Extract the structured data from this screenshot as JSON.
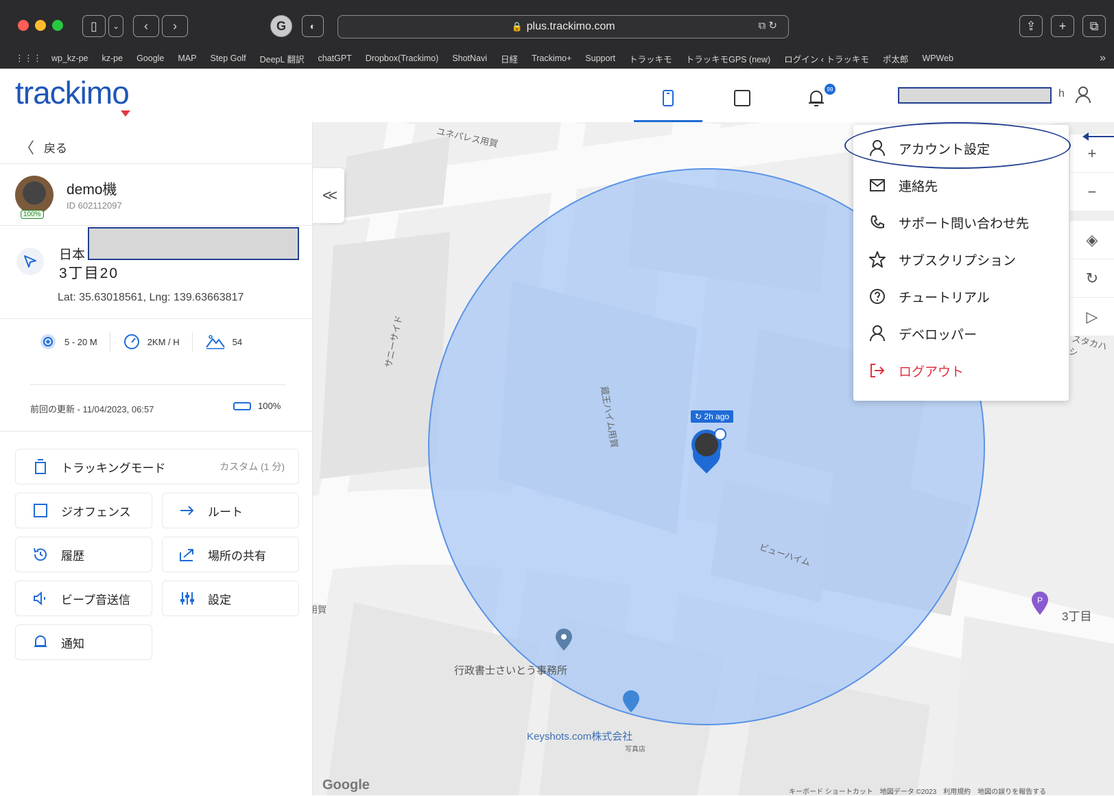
{
  "browser": {
    "url": "plus.trackimo.com",
    "bookmarks": [
      "wp_kz-pe",
      "kz-pe",
      "Google",
      "MAP",
      "Step Golf",
      "DeepL 翻訳",
      "chatGPT",
      "Dropbox(Trackimo)",
      "ShotNavi",
      "日経",
      "Trackimo+",
      "Support",
      "トラッキモ",
      "トラッキモGPS (new)",
      "ログイン ‹ トラッキモ",
      "ポ太郎",
      "WPWeb"
    ],
    "more": "»"
  },
  "app": {
    "logo": "trackimo",
    "notification_badge": "99"
  },
  "panel": {
    "back": "戻る",
    "device_name": "demo機",
    "device_id": "ID 602112097",
    "avatar_battery": "100%",
    "address_line1": "日本",
    "address_line2": "3丁目20",
    "latlng": "Lat: 35.63018561, Lng: 139.63663817",
    "stats": {
      "accuracy": "5 - 20 M",
      "speed": "2KM / H",
      "altitude": "54"
    },
    "last_update": "前回の更新 - 11/04/2023, 06:57",
    "battery": "100%",
    "tracking_mode": "トラッキングモード",
    "tracking_mode_value": "カスタム (1 分)",
    "geofence": "ジオフェンス",
    "route": "ルート",
    "history": "履歴",
    "share_location": "場所の共有",
    "beep": "ビープ音送信",
    "settings": "設定",
    "notifications": "通知"
  },
  "map": {
    "labels": {
      "top": "ユネパレス用賀",
      "sunny_side": "サニーサイド",
      "zao": "蔵王ハイム用賀",
      "view_heim": "ビューハイム",
      "left_edge": "用賀",
      "right_edge": "スタカハシ",
      "gyosei": "行政書士さいとう事務所",
      "keyshots": "Keyshots.com株式会社",
      "keyshots_sub": "写真店",
      "chome": "3丁目"
    },
    "time_ago": "2h ago",
    "google": "Google",
    "attribution": "キーボード ショートカット　地図データ ©2023　利用規約　地図の誤りを報告する",
    "accent": "#1f6bd6",
    "circle_fill": "#a9c8f5"
  },
  "menu": {
    "items": [
      {
        "label": "アカウント設定",
        "icon": "user-icon"
      },
      {
        "label": "連絡先",
        "icon": "mail-icon"
      },
      {
        "label": "サポート問い合わせ先",
        "icon": "phone-icon"
      },
      {
        "label": "サブスクリプション",
        "icon": "star-icon"
      },
      {
        "label": "チュートリアル",
        "icon": "help-icon"
      },
      {
        "label": "デベロッパー",
        "icon": "user-icon"
      },
      {
        "label": "ログアウト",
        "icon": "logout-icon"
      }
    ]
  }
}
